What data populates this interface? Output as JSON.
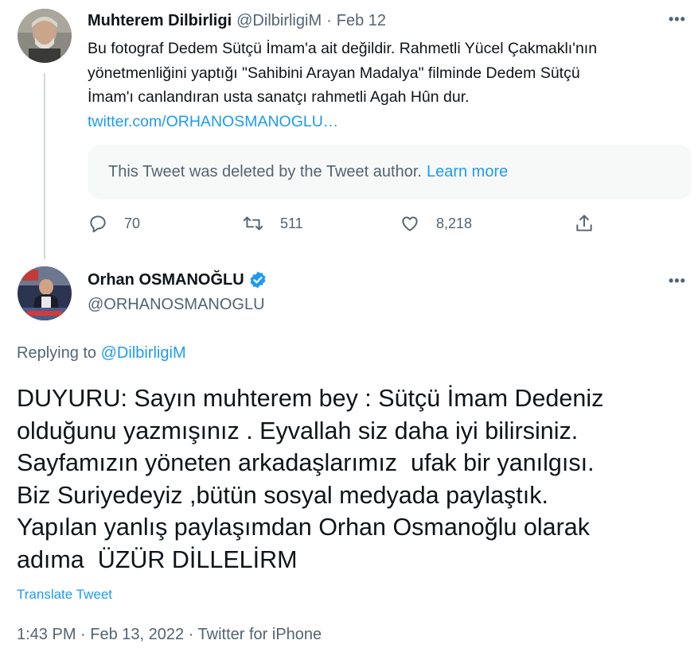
{
  "parent_tweet": {
    "author_name": "Muhterem Dilbirligi",
    "author_handle": "@DilbirligiM",
    "separator": "·",
    "date": "Feb 12",
    "more": "•••",
    "body_lines": [
      "Bu fotograf Dedem Sütçü İmam'a ait değildir. Rahmetli Yücel Çakmaklı'nın",
      "yönetmenliğini yaptığı \"Sahibini Arayan Madalya\" filminde Dedem Sütçü",
      "İmam'ı canlandıran usta sanatçı rahmetli Agah Hûn dur."
    ],
    "link_text": "twitter.com/ORHANOSMANOGLU…",
    "deleted_notice": "This Tweet was deleted by the Tweet author.",
    "learn_more": "Learn more",
    "reply_count": "70",
    "retweet_count": "511",
    "like_count": "8,218"
  },
  "main_tweet": {
    "author_name": "Orhan OSMANOĞLU",
    "author_handle": "@ORHANOSMANOGLU",
    "more": "•••",
    "replying_prefix": "Replying to ",
    "replying_to": "@DilbirligiM",
    "body_lines": [
      "DUYURU: Sayın muhterem bey : Sütçü İmam Dedeniz",
      "olduğunu yazmışınız . Eyvallah siz daha iyi bilirsiniz.",
      "Sayfamızın yöneten arkadaşlarımız  ufak bir yanılgısı.",
      "Biz Suriyedeyiz ,bütün sosyal medyada paylaştık.",
      "Yapılan yanlış paylaşımdan Orhan Osmanoğlu olarak",
      "adıma  ÜZÜR DİLLELİRM"
    ],
    "translate": "Translate Tweet",
    "timestamp": "1:43 PM · Feb 13, 2022 · Twitter for iPhone"
  },
  "colors": {
    "text": "#0f1419",
    "secondary": "#536471",
    "accent": "#1d9bf0",
    "deleted_bg": "#f7f9f9"
  },
  "icons": [
    "reply-icon",
    "retweet-icon",
    "like-icon",
    "share-icon",
    "verified-badge-icon",
    "more-icon"
  ]
}
